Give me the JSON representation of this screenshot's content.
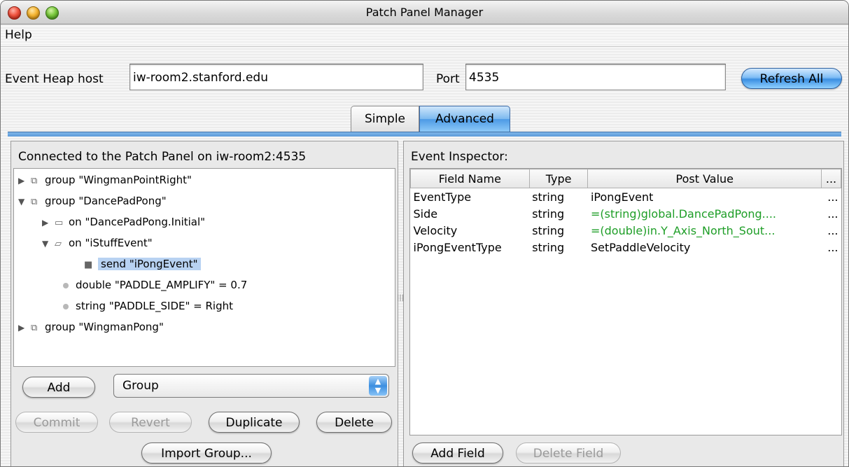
{
  "window": {
    "title": "Patch Panel Manager"
  },
  "menu": {
    "help": "Help"
  },
  "host": {
    "label": "Event Heap host",
    "value": "iw-room2.stanford.edu",
    "port_label": "Port",
    "port_value": "4535",
    "refresh_label": "Refresh All"
  },
  "tabs": {
    "simple": "Simple",
    "advanced": "Advanced"
  },
  "left": {
    "header": "Connected to the Patch Panel on iw-room2:4535",
    "tree": [
      "group \"WingmanPointRight\"",
      "group \"DancePadPong\"",
      "on \"DancePadPong.Initial\"",
      "on \"iStuffEvent\"",
      "send \"iPongEvent\"",
      "double \"PADDLE_AMPLIFY\" = 0.7",
      "string \"PADDLE_SIDE\" = Right",
      "group \"WingmanPong\""
    ],
    "add_label": "Add",
    "add_type": "Group",
    "commit": "Commit",
    "revert": "Revert",
    "duplicate": "Duplicate",
    "delete": "Delete",
    "import": "Import Group..."
  },
  "right": {
    "header": "Event Inspector:",
    "columns": [
      "Field Name",
      "Type",
      "Post Value",
      "..."
    ],
    "rows": [
      {
        "name": "EventType",
        "type": "string",
        "value": "iPongEvent",
        "more": "..."
      },
      {
        "name": "Side",
        "type": "string",
        "value": "=(string)global.DancePadPong....",
        "more": "..."
      },
      {
        "name": "Velocity",
        "type": "string",
        "value": "=(double)in.Y_Axis_North_Sout...",
        "more": "..."
      },
      {
        "name": "iPongEventType",
        "type": "string",
        "value": "SetPaddleVelocity",
        "more": "..."
      }
    ],
    "add_field": "Add Field",
    "delete_field": "Delete Field"
  },
  "colors": {
    "accent": "#3b8fe2",
    "green_text": "#1e9e27",
    "selection": "#b8d2f2"
  }
}
